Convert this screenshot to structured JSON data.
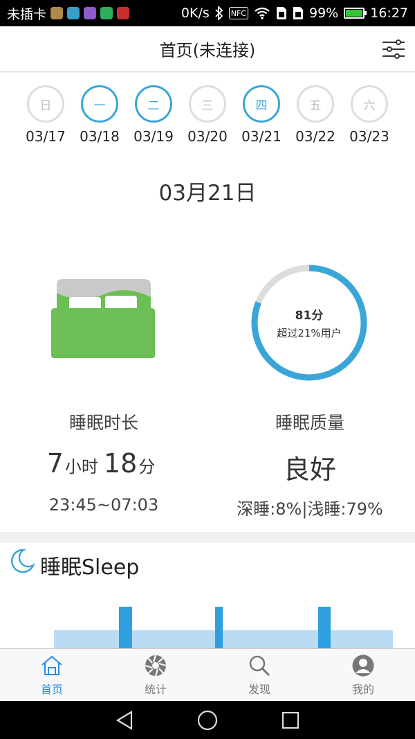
{
  "status_bar": {
    "carrier": "未插卡",
    "speed": "0K/s",
    "nfc": "NFC",
    "battery": "99%",
    "battery_level": 0.99,
    "time": "16:27"
  },
  "header": {
    "title": "首页(未连接)"
  },
  "week": [
    {
      "label": "日",
      "date": "03/17",
      "active": false
    },
    {
      "label": "一",
      "date": "03/18",
      "active": true
    },
    {
      "label": "二",
      "date": "03/19",
      "active": true
    },
    {
      "label": "三",
      "date": "03/20",
      "active": false
    },
    {
      "label": "四",
      "date": "03/21",
      "active": true
    },
    {
      "label": "五",
      "date": "03/22",
      "active": false
    },
    {
      "label": "六",
      "date": "03/23",
      "active": false
    }
  ],
  "selected_date": "03月21日",
  "score_ring": {
    "score": "81分",
    "subtitle": "超过21%用户",
    "progress": 0.81
  },
  "duration": {
    "label": "睡眠时长",
    "hours": "7",
    "hours_unit": "小时",
    "minutes": "18",
    "minutes_unit": "分",
    "range": "23:45~07:03"
  },
  "quality": {
    "label": "睡眠质量",
    "value": "良好",
    "detail": "深睡:8%|浅睡:79%"
  },
  "sleep_section": {
    "title": "睡眠Sleep"
  },
  "bottom_nav": [
    {
      "label": "首页",
      "icon": "home-icon",
      "active": true
    },
    {
      "label": "统计",
      "icon": "aperture-icon",
      "active": false
    },
    {
      "label": "发现",
      "icon": "search-icon",
      "active": false
    },
    {
      "label": "我的",
      "icon": "user-icon",
      "active": false
    }
  ],
  "colors": {
    "accent": "#3aa6d8",
    "nav_active": "#2a8ee0",
    "bed_green": "#6cbf55",
    "light_sleep": "#b9dcf3",
    "deep_sleep": "#2f9fe0"
  }
}
